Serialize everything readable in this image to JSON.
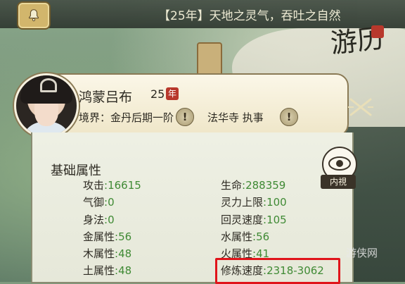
{
  "notice": {
    "text": "【25年】天地之灵气，吞吐之自然"
  },
  "scene": {
    "travel_label": "游历"
  },
  "character": {
    "name": "鸿蒙吕布",
    "age": "25",
    "age_unit": "年",
    "realm": "境界：金丹后期一阶",
    "sect": "法华寺 执事"
  },
  "attributes": {
    "title": "基础属性",
    "inner_sight_label": "内視",
    "left": [
      {
        "label": "攻击",
        "value": ":16615"
      },
      {
        "label": "气御",
        "value": ":0"
      },
      {
        "label": "身法",
        "value": ":0"
      },
      {
        "label": "金属性",
        "value": ":56"
      },
      {
        "label": "木属性",
        "value": ":48"
      },
      {
        "label": "土属性",
        "value": ":48"
      }
    ],
    "right": [
      {
        "label": "生命",
        "value": ":288359"
      },
      {
        "label": "灵力上限",
        "value": ":100"
      },
      {
        "label": "回灵速度",
        "value": ":105"
      },
      {
        "label": "水属性",
        "value": ":56"
      },
      {
        "label": "火属性",
        "value": ":41"
      },
      {
        "label": "修炼速度",
        "value": ":2318-3062"
      }
    ]
  },
  "watermark": "游侠网",
  "icons": {
    "notice": "bell-icon",
    "info": "exclamation-icon",
    "close": "crossed-swords-close-icon",
    "inner_sight": "eye-icon"
  },
  "colors": {
    "value_green": "#3f8a34",
    "highlight_red": "#e0141a"
  }
}
